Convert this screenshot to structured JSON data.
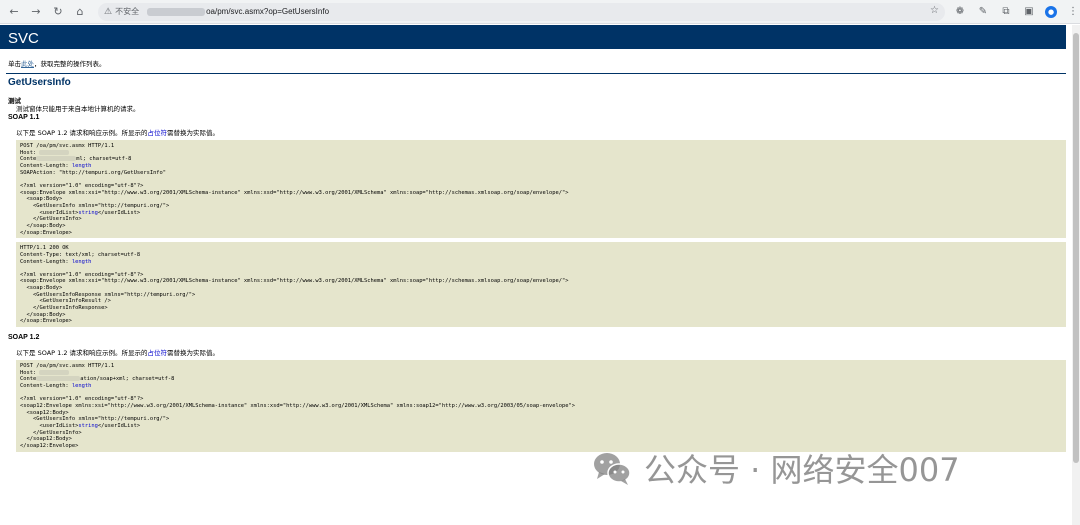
{
  "browser": {
    "back": "←",
    "forward": "→",
    "reload": "↻",
    "home": "⌂",
    "insecure_icon": "⚠",
    "insecure_label": "不安全",
    "url_path": "oa/pm/svc.asmx?op=GetUsersInfo",
    "bookmark": "☆",
    "ext": [
      "❁",
      "✎",
      "⧉",
      "▣",
      "⋮"
    ],
    "avatar": "●"
  },
  "page": {
    "title": "SVC",
    "intro_prefix": "单击",
    "intro_link": "此处",
    "intro_suffix": "，获取完整的操作列表。",
    "op_name": "GetUsersInfo",
    "test_heading": "测试",
    "test_note": "测试窗体只能用于来自本地计算机的请求。",
    "soap11_heading": "SOAP 1.1",
    "soap11_note_a": "以下是 SOAP 1.2 请求和响应示例。所显示的",
    "soap11_note_ph": "占位符",
    "soap11_note_b": "需替换为实际值。",
    "soap12_heading": "SOAP 1.2",
    "soap12_note_a": "以下是 SOAP 1.2 请求和响应示例。所显示的",
    "soap12_note_ph": "占位符",
    "soap12_note_b": "需替换为实际值。"
  },
  "code1": {
    "l1": "POST /oa/pm/svc.asmx HTTP/1.1",
    "l2": "Host: ",
    "l3a": "Conte",
    "l3b": "ml; charset=utf-8",
    "l4a": "Content-Length: ",
    "l4b": "length",
    "l5": "SOAPAction: \"http://tempuri.org/GetUsersInfo\"",
    "l6": "",
    "l7": "<?xml version=\"1.0\" encoding=\"utf-8\"?>",
    "l8": "<soap:Envelope xmlns:xsi=\"http://www.w3.org/2001/XMLSchema-instance\" xmlns:xsd=\"http://www.w3.org/2001/XMLSchema\" xmlns:soap=\"http://schemas.xmlsoap.org/soap/envelope/\">",
    "l9": "  <soap:Body>",
    "l10": "    <GetUsersInfo xmlns=\"http://tempuri.org/\">",
    "l11a": "      <userIdList>",
    "l11b": "string",
    "l11c": "</userIdList>",
    "l12": "    </GetUsersInfo>",
    "l13": "  </soap:Body>",
    "l14": "</soap:Envelope>"
  },
  "code2": {
    "l1": "HTTP/1.1 200 OK",
    "l2": "Content-Type: text/xml; charset=utf-8",
    "l3a": "Content-Length: ",
    "l3b": "length",
    "l4": "",
    "l5": "<?xml version=\"1.0\" encoding=\"utf-8\"?>",
    "l6": "<soap:Envelope xmlns:xsi=\"http://www.w3.org/2001/XMLSchema-instance\" xmlns:xsd=\"http://www.w3.org/2001/XMLSchema\" xmlns:soap=\"http://schemas.xmlsoap.org/soap/envelope/\">",
    "l7": "  <soap:Body>",
    "l8": "    <GetUsersInfoResponse xmlns=\"http://tempuri.org/\">",
    "l9": "      <GetUsersInfoResult />",
    "l10": "    </GetUsersInfoResponse>",
    "l11": "  </soap:Body>",
    "l12": "</soap:Envelope>"
  },
  "code3": {
    "l1": "POST /oa/pm/svc.asmx HTTP/1.1",
    "l2": "Host: ",
    "l3a": "Conte",
    "l3b": "ation/soap+xml; charset=utf-8",
    "l4a": "Content-Length: ",
    "l4b": "length",
    "l5": "",
    "l6": "<?xml version=\"1.0\" encoding=\"utf-8\"?>",
    "l7": "<soap12:Envelope xmlns:xsi=\"http://www.w3.org/2001/XMLSchema-instance\" xmlns:xsd=\"http://www.w3.org/2001/XMLSchema\" xmlns:soap12=\"http://www.w3.org/2003/05/soap-envelope\">",
    "l8": "  <soap12:Body>",
    "l9": "    <GetUsersInfo xmlns=\"http://tempuri.org/\">",
    "l10a": "      <userIdList>",
    "l10b": "string",
    "l10c": "</userIdList>",
    "l11": "    </GetUsersInfo>",
    "l12": "  </soap12:Body>",
    "l13": "</soap12:Envelope>"
  },
  "watermark": {
    "text": "公众号 · 网络安全007",
    "icon": "wechat-icon"
  }
}
